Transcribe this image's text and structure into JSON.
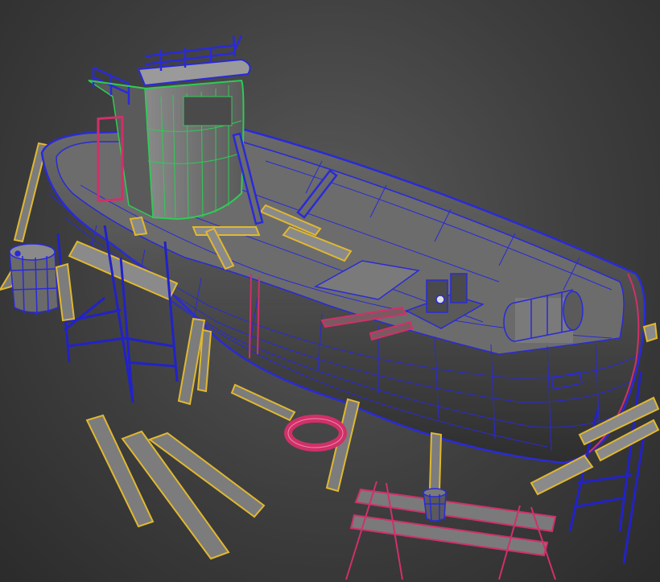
{
  "scene": {
    "description_objects": [
      "fishing-boat-hull",
      "wheelhouse",
      "scaffolding",
      "wooden-planks",
      "barrel",
      "cable-drum",
      "winch",
      "life-ring",
      "sawhorses"
    ],
    "colors": {
      "background": "#3e3e3e",
      "hull_wire": "#2a2ad8",
      "cabin_wire": "#2ecc55",
      "plank_wire": "#e0b830",
      "red_wire": "#d0306a",
      "surface": "#5c5c5c",
      "deck": "#6a6a6a"
    }
  }
}
